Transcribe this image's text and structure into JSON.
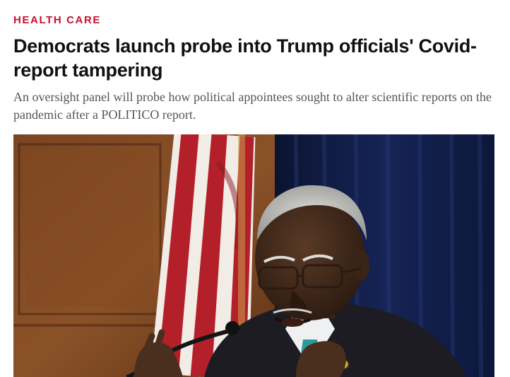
{
  "article": {
    "section": "HEALTH CARE",
    "headline": "Democrats launch probe into Trump officials' Covid-report tampering",
    "dek": "An oversight panel will probe how political appointees sought to alter scientific reports on the pandemic after a POLITICO report.",
    "image_subject": "man-with-glasses-at-microphone-photo"
  },
  "colors": {
    "section": "#c8102e",
    "headline": "#111111",
    "dek": "#555555",
    "background": "#ffffff"
  }
}
